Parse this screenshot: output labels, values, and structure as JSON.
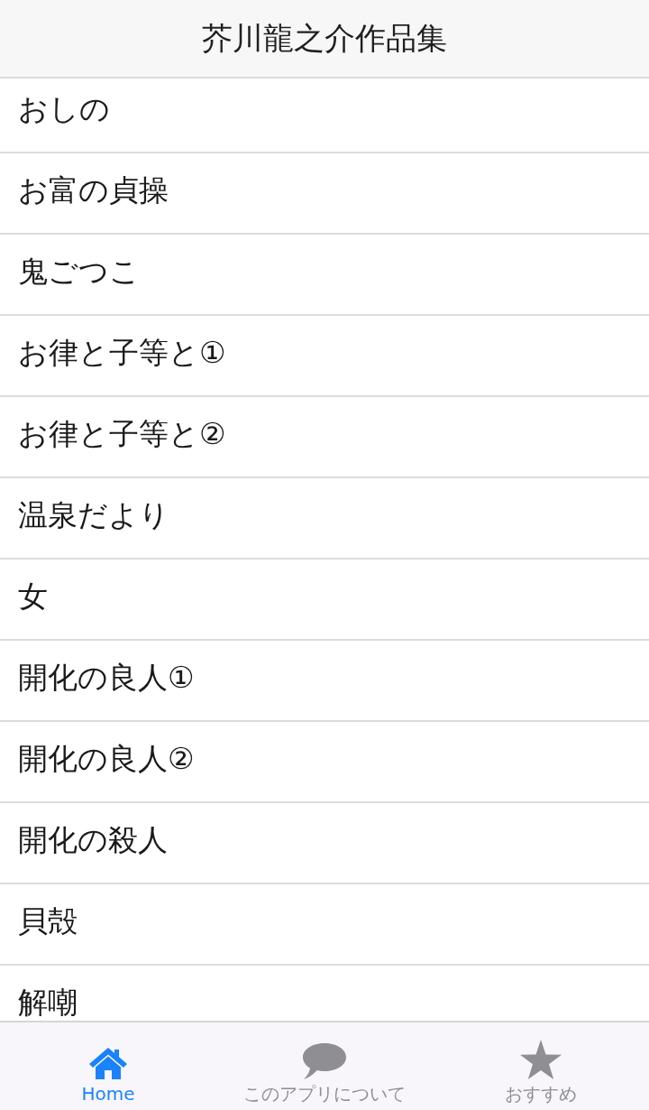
{
  "header": {
    "title": "芥川龍之介作品集"
  },
  "works": [
    {
      "label": "おしの"
    },
    {
      "label": "お富の貞操"
    },
    {
      "label": "鬼ごつこ"
    },
    {
      "label": "お律と子等と①"
    },
    {
      "label": "お律と子等と②"
    },
    {
      "label": "温泉だより"
    },
    {
      "label": "女"
    },
    {
      "label": "開化の良人①"
    },
    {
      "label": "開化の良人②"
    },
    {
      "label": "開化の殺人"
    },
    {
      "label": "貝殻"
    },
    {
      "label": "解嘲"
    }
  ],
  "tabs": [
    {
      "label": "Home",
      "selected": true
    },
    {
      "label": "このアプリについて",
      "selected": false
    },
    {
      "label": "おすすめ",
      "selected": false
    }
  ]
}
